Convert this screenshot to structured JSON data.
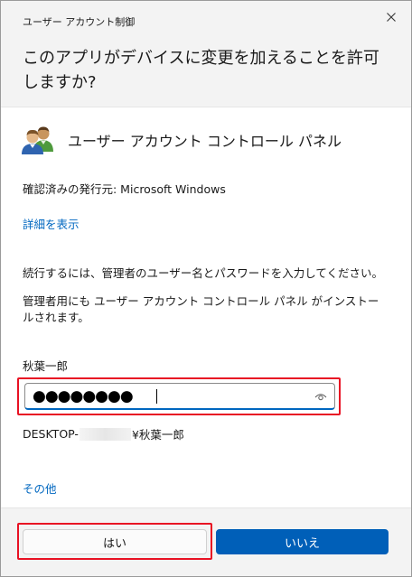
{
  "window": {
    "title": "ユーザー アカウント制御",
    "prompt": "このアプリがデバイスに変更を加えることを許可しますか?"
  },
  "app": {
    "name": "ユーザー アカウント コントロール パネル",
    "icon": "users-icon"
  },
  "details": {
    "publisher": "確認済みの発行元: Microsoft Windows",
    "show_details_link": "詳細を表示",
    "instructions": "続行するには、管理者のユーザー名とパスワードを入力してください。",
    "install_notice": "管理者用にも ユーザー アカウント コントロール パネル がインストールされます。"
  },
  "credentials": {
    "username": "秋葉一郎",
    "password_masked": "●●●●●●●●",
    "account_prefix": "DESKTOP-",
    "account_suffix": "¥秋葉一郎"
  },
  "more_link": "その他",
  "buttons": {
    "yes": "はい",
    "no": "いいえ"
  },
  "colors": {
    "accent": "#005fb8",
    "link": "#0067c0",
    "highlight": "#e81123"
  }
}
